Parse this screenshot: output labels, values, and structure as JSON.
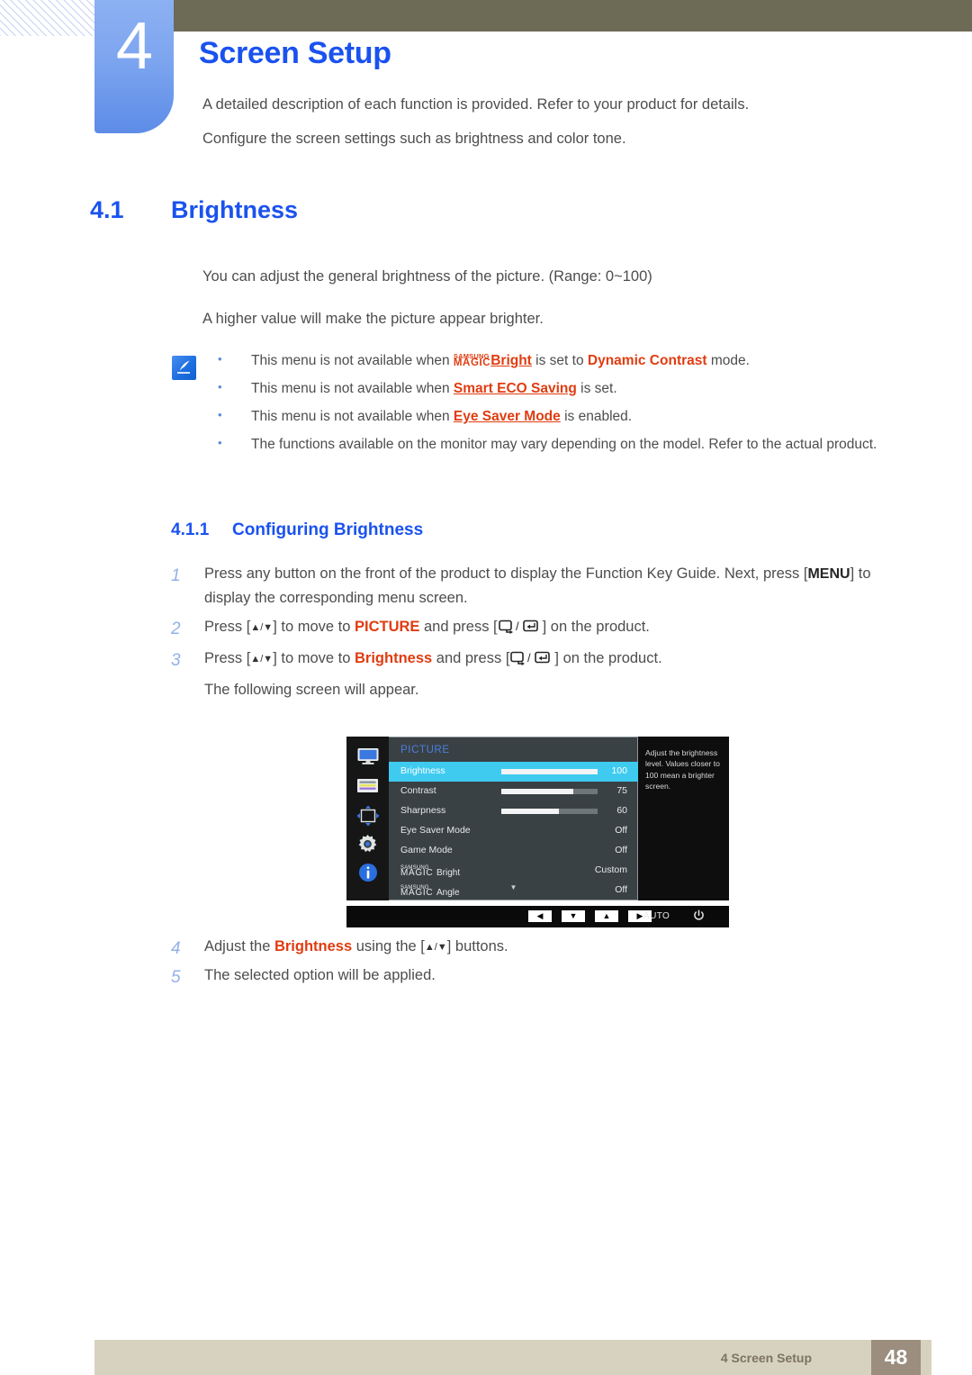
{
  "header": {
    "chapter_number": "4",
    "chapter_title": "Screen Setup",
    "intro_line_1": "A detailed description of each function is provided. Refer to your product for details.",
    "intro_line_2": "Configure the screen settings such as brightness and color tone.",
    "accent_blue": "#1a52ef",
    "olive": "#6d6a55"
  },
  "section": {
    "number": "4.1",
    "title": "Brightness",
    "paragraph_1": "You can adjust the general brightness of the picture. (Range: 0~100)",
    "paragraph_2": "A higher value will make the picture appear brighter."
  },
  "note": {
    "icon": "note-pen-icon",
    "items": [
      {
        "pre": "This menu is not available when ",
        "magic_small": "SAMSUNG",
        "magic_large": "MAGIC",
        "magic_suffix": "Bright",
        "mid": " is set to ",
        "emphasis": "Dynamic Contrast",
        "post": " mode."
      },
      {
        "pre": "This menu is not available when ",
        "emphasis": "Smart ECO Saving",
        "post": " is set."
      },
      {
        "pre": "This menu is not available when ",
        "emphasis": "Eye Saver Mode",
        "post": " is enabled."
      },
      {
        "pre": "The functions available on the monitor may vary depending on the model. Refer to the actual product.",
        "emphasis": "",
        "post": ""
      }
    ]
  },
  "subsection": {
    "number": "4.1.1",
    "title": "Configuring Brightness"
  },
  "steps": [
    {
      "n": "1",
      "pre": "Press any button on the front of the product to display the Function Key Guide. Next, press [",
      "kbd": "MENU",
      "post": "] to display the corresponding menu screen."
    },
    {
      "n": "2",
      "pre": "Press [",
      "arrows": "▲/▼",
      "mid1": "] to move to ",
      "emphasis": "PICTURE",
      "mid2": " and press [",
      "mid3": "] on the product."
    },
    {
      "n": "3",
      "pre": "Press [",
      "arrows": "▲/▼",
      "mid1": "] to move to ",
      "emphasis": "Brightness",
      "mid2": " and press [",
      "mid3": "] on the product."
    }
  ],
  "step3_note": "The following screen will appear.",
  "steps_after": [
    {
      "n": "4",
      "pre": "Adjust the ",
      "emphasis": "Brightness",
      "mid": " using the [",
      "arrows": "▲/▼",
      "post": "] buttons."
    },
    {
      "n": "5",
      "pre": "The selected option will be applied.",
      "emphasis": "",
      "mid": "",
      "arrows": "",
      "post": ""
    }
  ],
  "osd": {
    "menu_title": "PICTURE",
    "title_color": "#4a7fe0",
    "highlight_color": "#3fcbf0",
    "sidebar_icons": [
      "monitor-icon",
      "color-panel-icon",
      "resize-arrows-icon",
      "gear-icon",
      "info-icon"
    ],
    "rows": [
      {
        "label": "Brightness",
        "value": "100",
        "slider": 100,
        "active": true
      },
      {
        "label": "Contrast",
        "value": "75",
        "slider": 75,
        "active": false
      },
      {
        "label": "Sharpness",
        "value": "60",
        "slider": 60,
        "active": false
      },
      {
        "label": "Eye Saver Mode",
        "value": "Off",
        "slider": null,
        "active": false
      },
      {
        "label": "Game Mode",
        "value": "Off",
        "slider": null,
        "active": false
      }
    ],
    "magic_rows": [
      {
        "small": "SAMSUNG",
        "large": "MAGIC",
        "suffix": "Bright",
        "value": "Custom"
      },
      {
        "small": "SAMSUNG",
        "large": "MAGIC",
        "suffix": "Angle",
        "value": "Off"
      }
    ],
    "scroll_down": "▼",
    "help_text": "Adjust the brightness level. Values closer to 100 mean a brighter screen.",
    "bottom_buttons": [
      "◀",
      "▼",
      "▲",
      "▶"
    ],
    "auto_label": "AUTO",
    "power_icon": "⏻"
  },
  "footer": {
    "text": "4 Screen Setup",
    "page_number": "48",
    "bar_color": "#d7d2bf",
    "page_box_color": "#9b8e7e"
  }
}
